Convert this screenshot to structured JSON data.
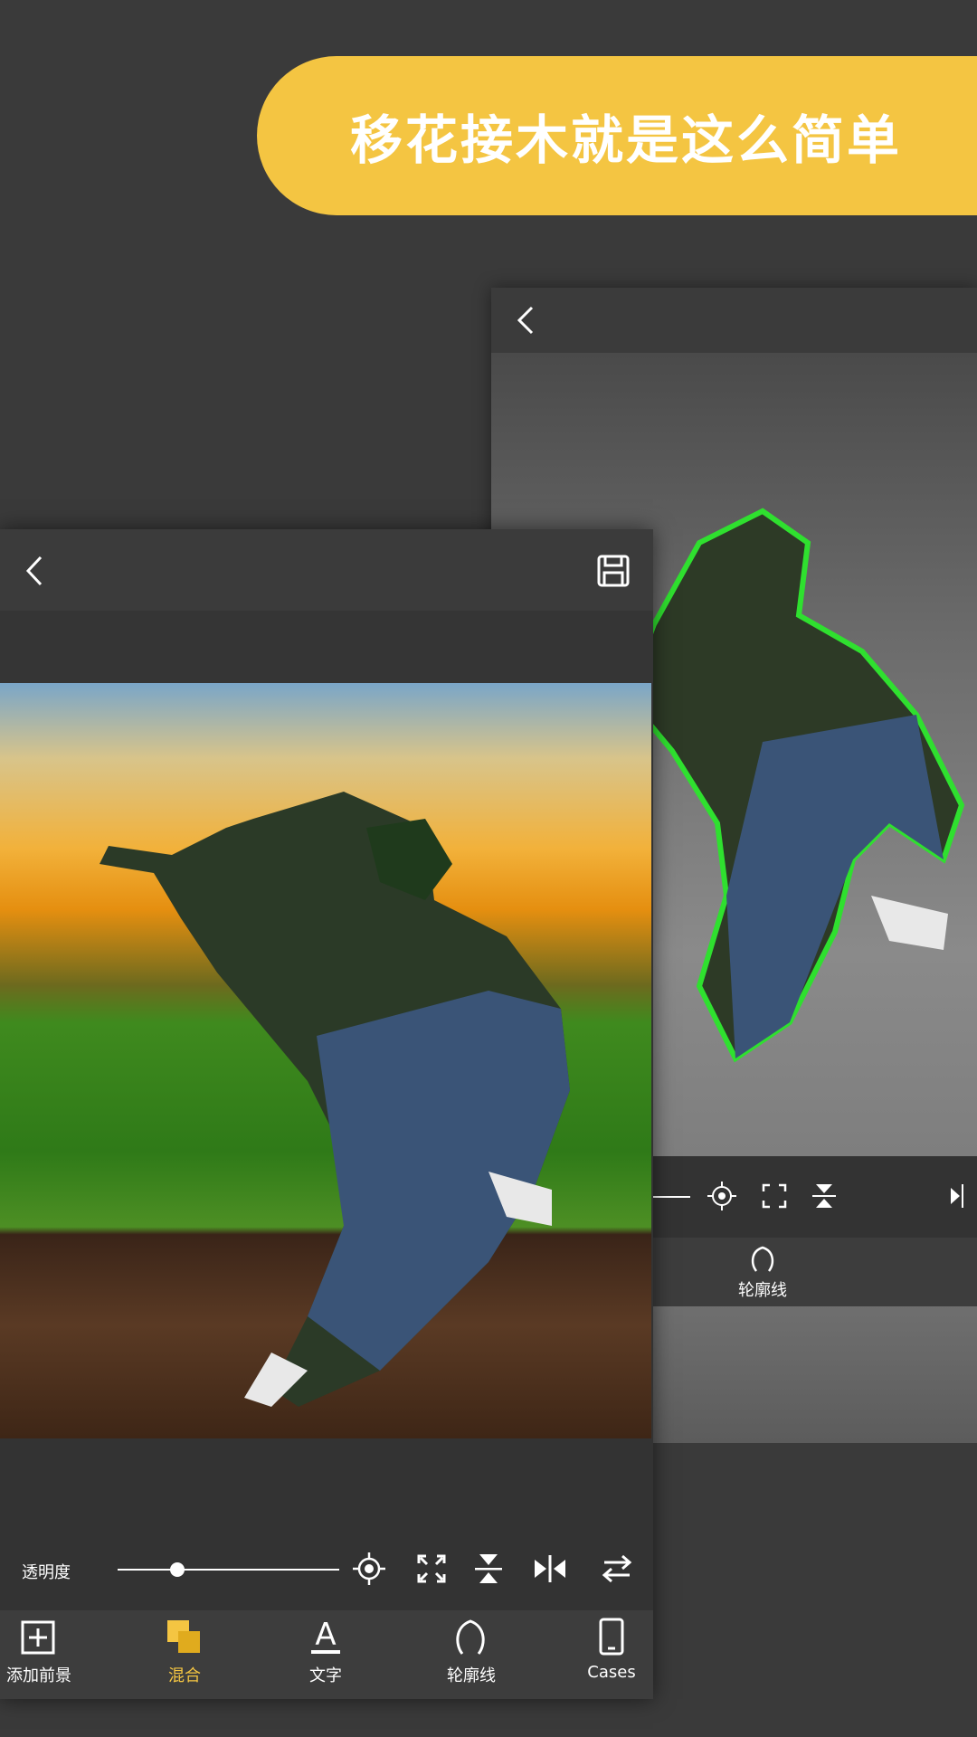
{
  "banner": {
    "text": "移花接木就是这么简单"
  },
  "back_screen": {
    "tabs": [
      {
        "label": "混合",
        "icon": "blend-icon"
      },
      {
        "label": "文字",
        "icon": "text-icon"
      },
      {
        "label": "轮廓线",
        "icon": "outline-icon"
      }
    ]
  },
  "front_screen": {
    "opacity_label": "透明度",
    "opacity_value": 0.27,
    "tabs": [
      {
        "label": "添加前景",
        "icon": "add-foreground-icon"
      },
      {
        "label": "混合",
        "icon": "blend-icon",
        "active": true
      },
      {
        "label": "文字",
        "icon": "text-icon"
      },
      {
        "label": "轮廓线",
        "icon": "outline-icon"
      },
      {
        "label": "Cases",
        "icon": "cases-icon"
      }
    ]
  },
  "colors": {
    "accent": "#f4c542",
    "background": "#3a3a3a",
    "outline": "#2fe02f"
  }
}
